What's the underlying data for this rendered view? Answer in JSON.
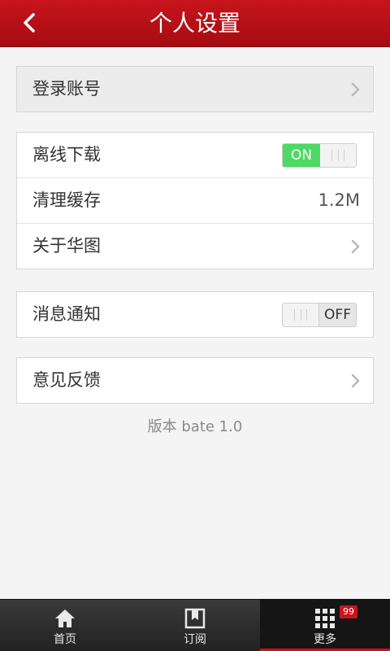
{
  "header": {
    "title": "个人设置"
  },
  "login": {
    "label": "登录账号"
  },
  "settings": {
    "offline": {
      "label": "离线下载",
      "state": "ON"
    },
    "cache": {
      "label": "清理缓存",
      "value": "1.2M"
    },
    "about": {
      "label": "关于华图"
    }
  },
  "notify": {
    "label": "消息通知",
    "state": "OFF"
  },
  "feedback": {
    "label": "意见反馈"
  },
  "version": "版本  bate 1.0",
  "tabs": [
    {
      "label": "首页",
      "icon": "home-icon"
    },
    {
      "label": "订阅",
      "icon": "book-icon"
    },
    {
      "label": "更多",
      "icon": "grid-icon",
      "badge": "99"
    }
  ],
  "colors": {
    "brand": "#c8141c",
    "toggle_on": "#4cd964"
  }
}
